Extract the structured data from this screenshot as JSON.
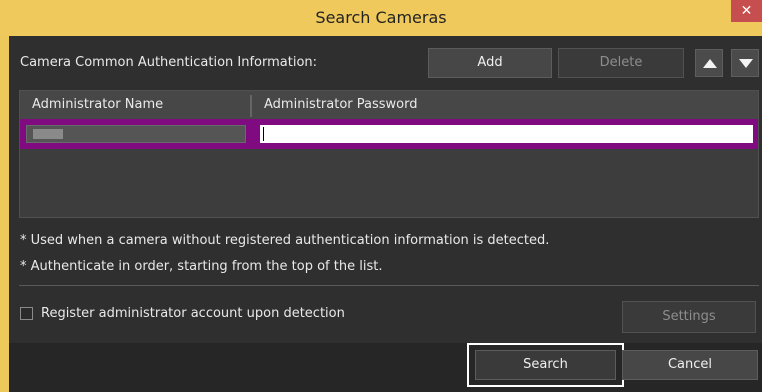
{
  "window": {
    "title": "Search Cameras",
    "close_glyph": "✕"
  },
  "auth": {
    "section_label": "Camera Common Authentication Information:",
    "add_label": "Add",
    "delete_label": "Delete"
  },
  "grid": {
    "columns": [
      "Administrator Name",
      "Administrator Password"
    ]
  },
  "notes": [
    "* Used when a camera without registered authentication information is detected.",
    "* Authenticate in order, starting from the top of the list."
  ],
  "register": {
    "label": "Register administrator account upon detection",
    "checked": false
  },
  "buttons": {
    "settings": "Settings",
    "search": "Search",
    "cancel": "Cancel"
  },
  "colors": {
    "title_bar": "#f0c95c",
    "selected_row": "#800a80",
    "close_button": "#c74e4e",
    "background": "#2f2f2f"
  }
}
